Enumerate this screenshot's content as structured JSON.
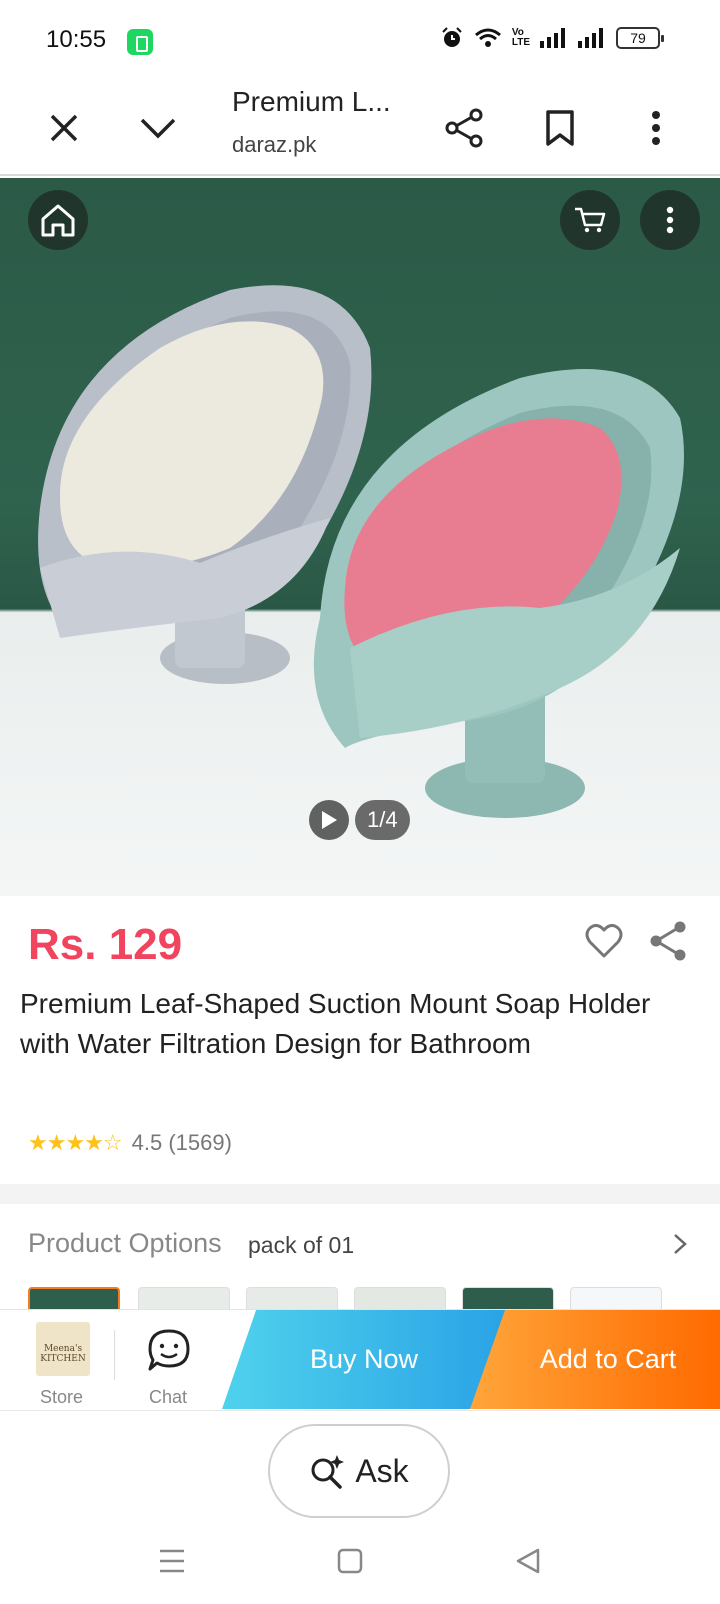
{
  "status": {
    "time": "10:55",
    "battery": "79",
    "network": "VoLTE"
  },
  "browser": {
    "tab_title": "Premium L...",
    "domain": "daraz.pk"
  },
  "hero": {
    "image_counter": "1/4"
  },
  "product": {
    "price": "Rs. 129",
    "title": "Premium Leaf-Shaped Suction Mount Soap Holder with Water Filtration Design for Bathroom",
    "rating": "4.5",
    "review_count": "(1569)",
    "stars_filled": 4.5
  },
  "options": {
    "label": "Product Options",
    "value": "pack of 01"
  },
  "action_bar": {
    "store_label": "Store",
    "store_logo_text": "Meena's KITCHEN",
    "chat_label": "Chat",
    "buy_now": "Buy Now",
    "add_to_cart": "Add to Cart"
  },
  "ask": {
    "label": "Ask"
  },
  "colors": {
    "price": "#f1455f",
    "buy_now": "#2aa3e6",
    "add_to_cart": "#ff6a00",
    "star": "#ffc21a"
  },
  "icons": [
    "close-icon",
    "chevron-down-icon",
    "share-icon",
    "bookmark-icon",
    "more-vert-icon",
    "home-icon",
    "cart-icon",
    "play-icon",
    "heart-icon",
    "chat-icon",
    "sparkle-search-icon",
    "nav-menu-icon",
    "nav-home-icon",
    "nav-back-icon"
  ]
}
